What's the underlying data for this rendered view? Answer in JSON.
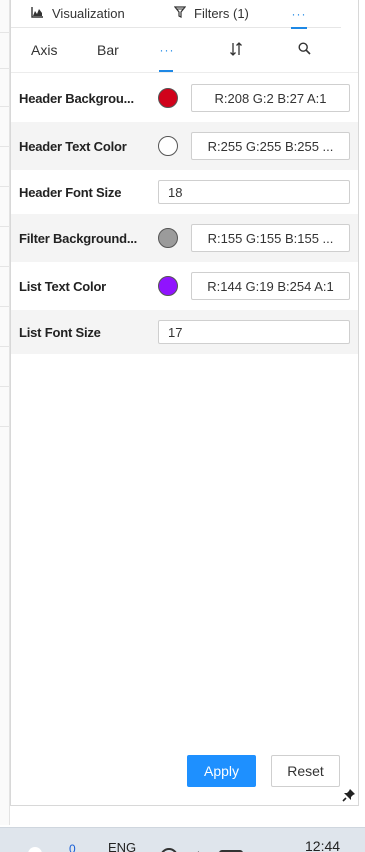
{
  "top_tabs": {
    "visualization": "Visualization",
    "filters": "Filters (1)",
    "more": "···"
  },
  "sub_tabs": {
    "axis": "Axis",
    "bar": "Bar",
    "more": "···"
  },
  "properties": [
    {
      "label": "Header Backgrou...",
      "swatch": "#d0021b",
      "value": "R:208 G:2 B:27 A:1"
    },
    {
      "label": "Header Text Color",
      "swatch": "#ffffff",
      "value": "R:255 G:255 B:255 ..."
    },
    {
      "label": "Header Font Size",
      "value": "18"
    },
    {
      "label": "Filter Background...",
      "swatch": "#9b9b9b",
      "value": "R:155 G:155 B:155 ..."
    },
    {
      "label": "List Text Color",
      "swatch": "#9013fe",
      "value": "R:144 G:19 B:254 A:1"
    },
    {
      "label": "List Font Size",
      "value": "17"
    }
  ],
  "buttons": {
    "apply": "Apply",
    "reset": "Reset"
  },
  "icons": {
    "visualization": "chart-area-icon",
    "filters": "funnel-icon",
    "sort": "sort-icon",
    "search": "search-icon",
    "pin": "pin-icon"
  },
  "taskbar": {
    "notification_count": "0",
    "language": "ENG",
    "time": "12:44"
  },
  "colors": {
    "accent": "#1e90ff"
  }
}
